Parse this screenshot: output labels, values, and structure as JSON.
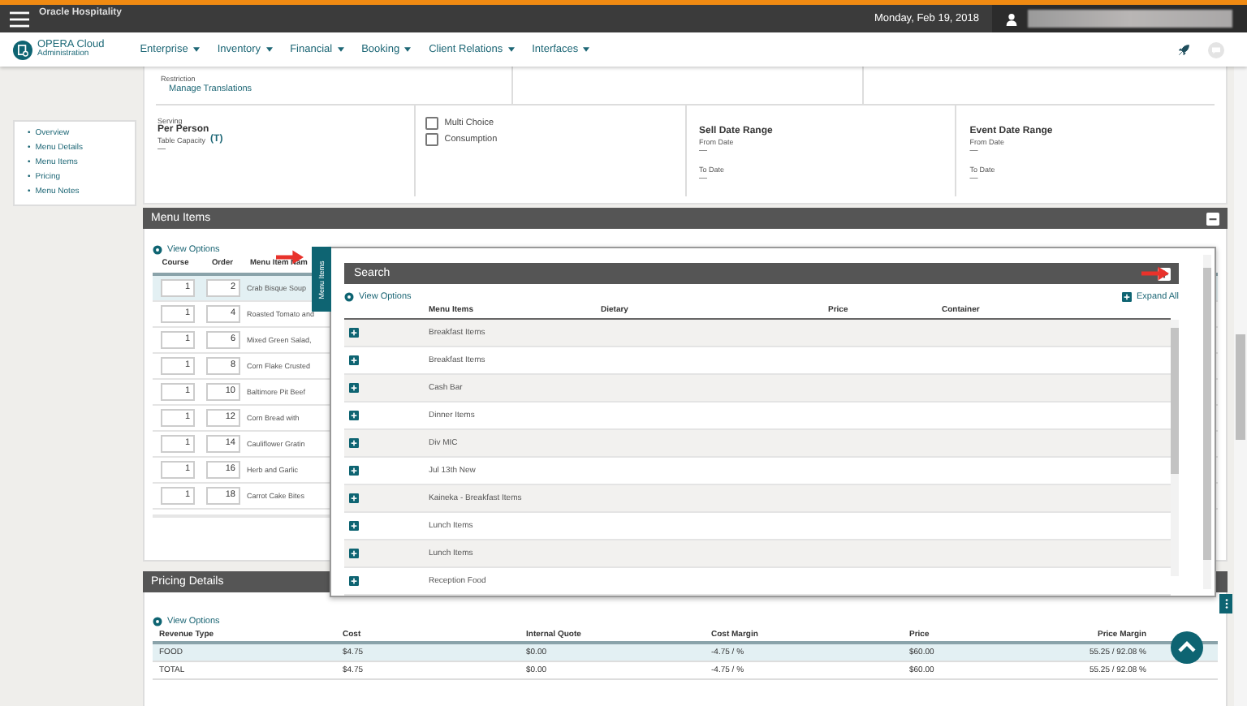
{
  "header": {
    "logo_text": "Oracle Hospitality",
    "date": "Monday, Feb 19, 2018"
  },
  "app": {
    "name": "OPERA Cloud",
    "subtitle": "Administration"
  },
  "nav": [
    {
      "label": "Enterprise"
    },
    {
      "label": "Inventory"
    },
    {
      "label": "Financial"
    },
    {
      "label": "Booking"
    },
    {
      "label": "Client Relations"
    },
    {
      "label": "Interfaces"
    }
  ],
  "sidebar": [
    {
      "bullet": "•",
      "label": "Overview"
    },
    {
      "bullet": "•",
      "label": "Menu Details"
    },
    {
      "bullet": "•",
      "label": "Menu Items"
    },
    {
      "bullet": "•",
      "label": "Pricing"
    },
    {
      "bullet": "•",
      "label": "Menu Notes"
    }
  ],
  "details": {
    "restriction_label": "Restriction",
    "manage_link": "Manage Translations",
    "serving_label": "Serving",
    "serving_value": "Per Person",
    "capacity_label": "Table Capacity",
    "capacity_mark": "(T)",
    "capacity_value": "—",
    "checkboxes": [
      {
        "label": "Multi Choice",
        "checked": false
      },
      {
        "label": "Consumption",
        "checked": false
      }
    ],
    "ranges": [
      {
        "title": "Sell Date Range",
        "from_label": "From Date",
        "from_value": "—",
        "to_label": "To Date",
        "to_value": "—"
      },
      {
        "title": "Event Date Range",
        "from_label": "From Date",
        "from_value": "—",
        "to_label": "To Date",
        "to_value": "—"
      }
    ]
  },
  "menu_items": {
    "title": "Menu Items",
    "view_options": "View Options",
    "tab_label": "Menu Items",
    "columns": [
      "Course",
      "Order",
      "Menu Item Nam"
    ],
    "rows": [
      {
        "course": "1",
        "order": "2",
        "name": "Crab Bisque Soup",
        "selected": true
      },
      {
        "course": "1",
        "order": "4",
        "name": "Roasted Tomato and",
        "selected": false
      },
      {
        "course": "1",
        "order": "6",
        "name": "Mixed Green Salad,",
        "selected": false
      },
      {
        "course": "1",
        "order": "8",
        "name": "Corn Flake Crusted",
        "selected": false
      },
      {
        "course": "1",
        "order": "10",
        "name": "Baltimore Pit Beef",
        "selected": false
      },
      {
        "course": "1",
        "order": "12",
        "name": "Corn Bread with",
        "selected": false
      },
      {
        "course": "1",
        "order": "14",
        "name": "Cauliflower Gratin",
        "selected": false
      },
      {
        "course": "1",
        "order": "16",
        "name": "Herb and Garlic",
        "selected": false
      },
      {
        "course": "1",
        "order": "18",
        "name": "Carrot Cake Bites",
        "selected": false
      }
    ]
  },
  "search": {
    "title": "Search",
    "view_options": "View Options",
    "expand_all": "Expand All",
    "columns": [
      "Menu Items",
      "Dietary",
      "Price",
      "Container"
    ],
    "rows": [
      {
        "name": "Breakfast Items",
        "expanded": false
      },
      {
        "name": "Breakfast Items",
        "expanded": false
      },
      {
        "name": "Cash Bar",
        "expanded": false
      },
      {
        "name": "Dinner Items",
        "expanded": false
      },
      {
        "name": "Div MIC",
        "expanded": false
      },
      {
        "name": "Jul 13th New",
        "expanded": false
      },
      {
        "name": "Kaineka - Breakfast Items",
        "expanded": false
      },
      {
        "name": "Lunch Items",
        "expanded": false
      },
      {
        "name": "Lunch Items",
        "expanded": false
      },
      {
        "name": "Reception Food",
        "expanded": false
      }
    ]
  },
  "pricing": {
    "title": "Pricing Details",
    "view_options": "View Options",
    "columns": [
      "Revenue Type",
      "Cost",
      "Internal Quote",
      "Cost Margin",
      "Price",
      "Price Margin"
    ],
    "rows": [
      {
        "cells": [
          "FOOD",
          "$4.75",
          "$0.00",
          "-4.75 / %",
          "$60.00",
          "55.25 / 92.08 %"
        ],
        "selected": true
      },
      {
        "cells": [
          "TOTAL",
          "$4.75",
          "$0.00",
          "-4.75 / %",
          "$60.00",
          "55.25 / 92.08 %"
        ],
        "selected": false
      }
    ]
  }
}
